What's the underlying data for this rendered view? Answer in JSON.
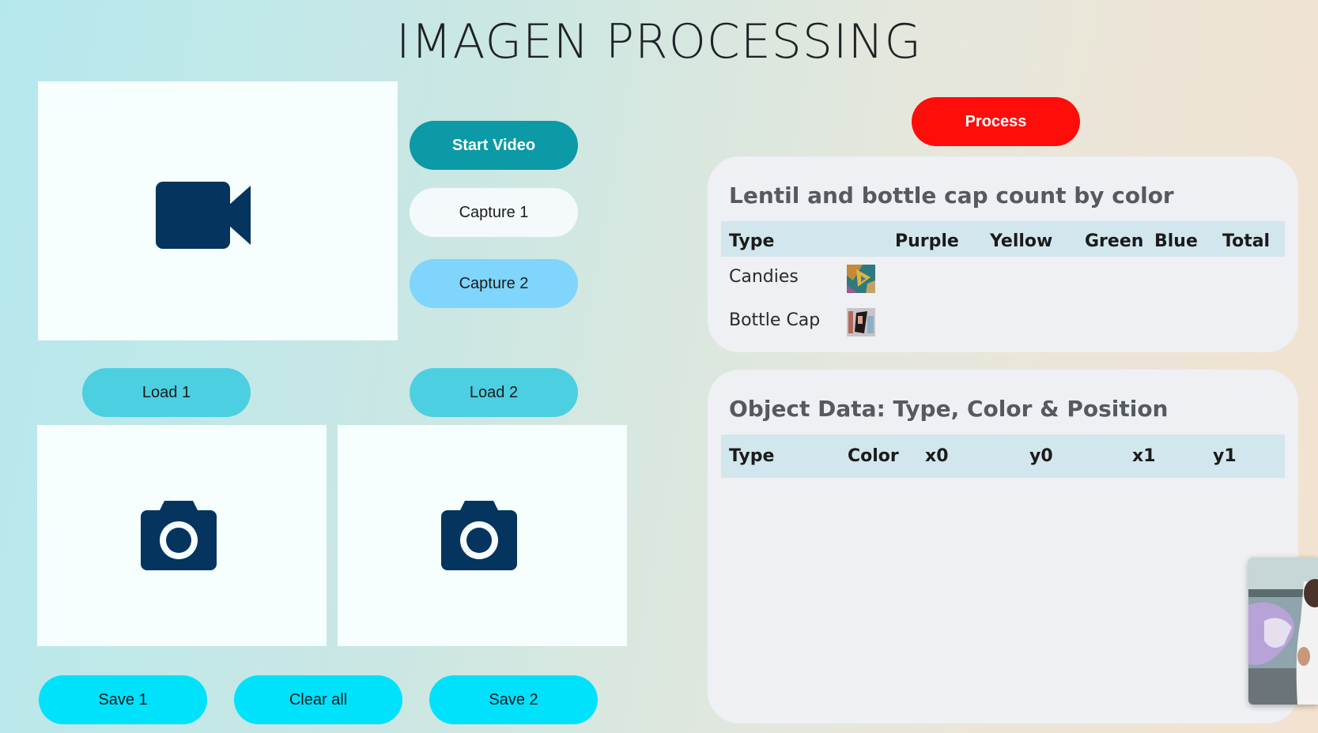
{
  "header": {
    "title": "IMAGEN PROCESSING"
  },
  "controls": {
    "start_video": "Start Video",
    "capture_1": "Capture 1",
    "capture_2": "Capture 2",
    "load_1": "Load 1",
    "load_2": "Load 2",
    "save_1": "Save 1",
    "clear_all": "Clear all",
    "save_2": "Save 2",
    "process": "Process"
  },
  "panels": {
    "video": {
      "icon": "video-camera-icon"
    },
    "image_1": {
      "icon": "camera-icon"
    },
    "image_2": {
      "icon": "camera-icon"
    }
  },
  "count_table": {
    "title": "Lentil and bottle cap count by color",
    "columns": [
      "Type",
      "Purple",
      "Yellow",
      "Green",
      "Blue",
      "Total"
    ],
    "rows": [
      {
        "type": "Candies",
        "thumbnail": "candies-thumbnail",
        "purple": "",
        "yellow": "",
        "green": "",
        "blue": "",
        "total": ""
      },
      {
        "type": "Bottle Cap",
        "thumbnail": "bottle-cap-thumbnail",
        "purple": "",
        "yellow": "",
        "green": "",
        "blue": "",
        "total": ""
      }
    ]
  },
  "object_table": {
    "title": "Object Data: Type, Color & Position",
    "columns": [
      "Type",
      "Color",
      "x0",
      "y0",
      "x1",
      "y1"
    ],
    "rows": []
  },
  "colors": {
    "icon": "#05345e",
    "start_video": "#0b9aa6",
    "process": "#fe0d0a",
    "save": "#00e1fc",
    "load": "#4ccfe0",
    "capture_2": "#7fd5fb"
  }
}
